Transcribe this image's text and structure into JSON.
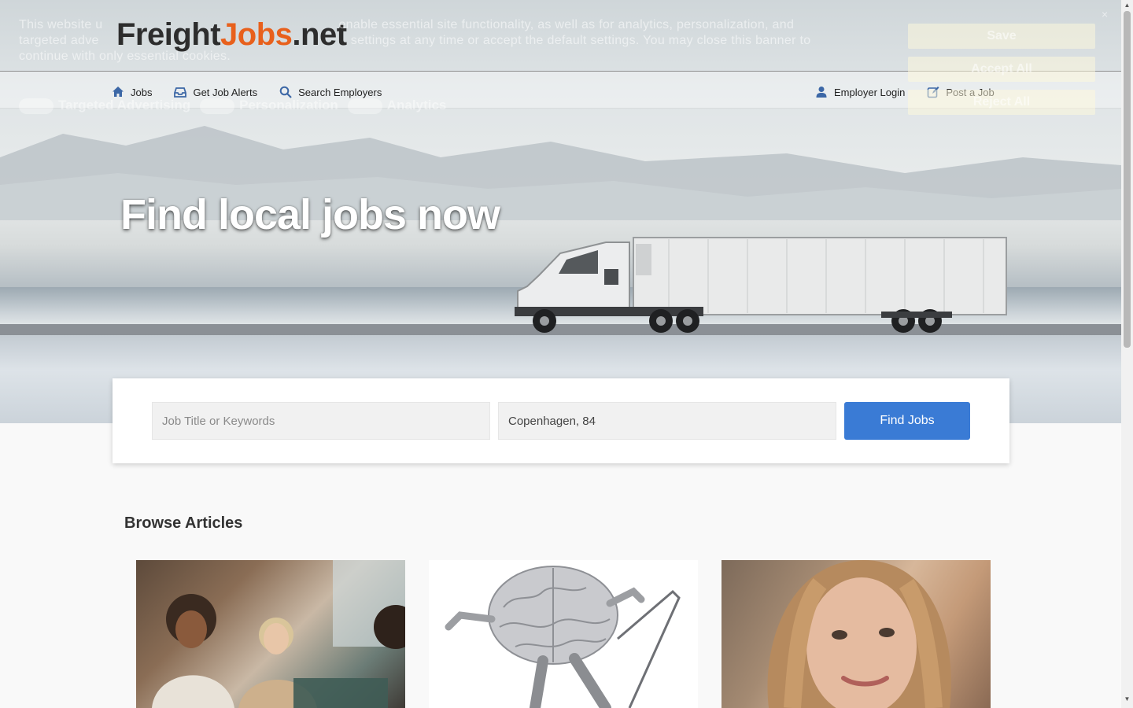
{
  "header": {
    "logo": {
      "part1": "Freight",
      "part2": "Jobs",
      "part3": ".net"
    },
    "nav_left": [
      {
        "label": "Jobs",
        "icon": "home-icon"
      },
      {
        "label": "Get Job Alerts",
        "icon": "inbox-icon"
      },
      {
        "label": "Search Employers",
        "icon": "search-icon"
      }
    ],
    "nav_right": [
      {
        "label": "Employer Login",
        "icon": "user-icon"
      },
      {
        "label": "Post a Job",
        "icon": "edit-icon"
      }
    ]
  },
  "cookie_banner": {
    "text_visible_1": "This website u",
    "text_visible_2": "enable essential site functionality, as well as for analytics, personalization, and",
    "text_visible_3": "targeted adve",
    "text_visible_4": "settings at any time or accept the default settings. You may close this banner to",
    "text_visible_5": "continue with only essential cookies.",
    "buttons": [
      "Save",
      "Accept All",
      "Reject All"
    ],
    "toggles": [
      "Targeted Advertising",
      "Personalization",
      "Analytics"
    ],
    "close_glyph": "×"
  },
  "hero": {
    "title": "Find local jobs now"
  },
  "search": {
    "keywords_placeholder": "Job Title or Keywords",
    "location_value": "Copenhagen, 84",
    "button_label": "Find Jobs"
  },
  "articles": {
    "title": "Browse Articles"
  },
  "colors": {
    "brand_orange": "#e8601c",
    "button_blue": "#3a7bd5"
  }
}
